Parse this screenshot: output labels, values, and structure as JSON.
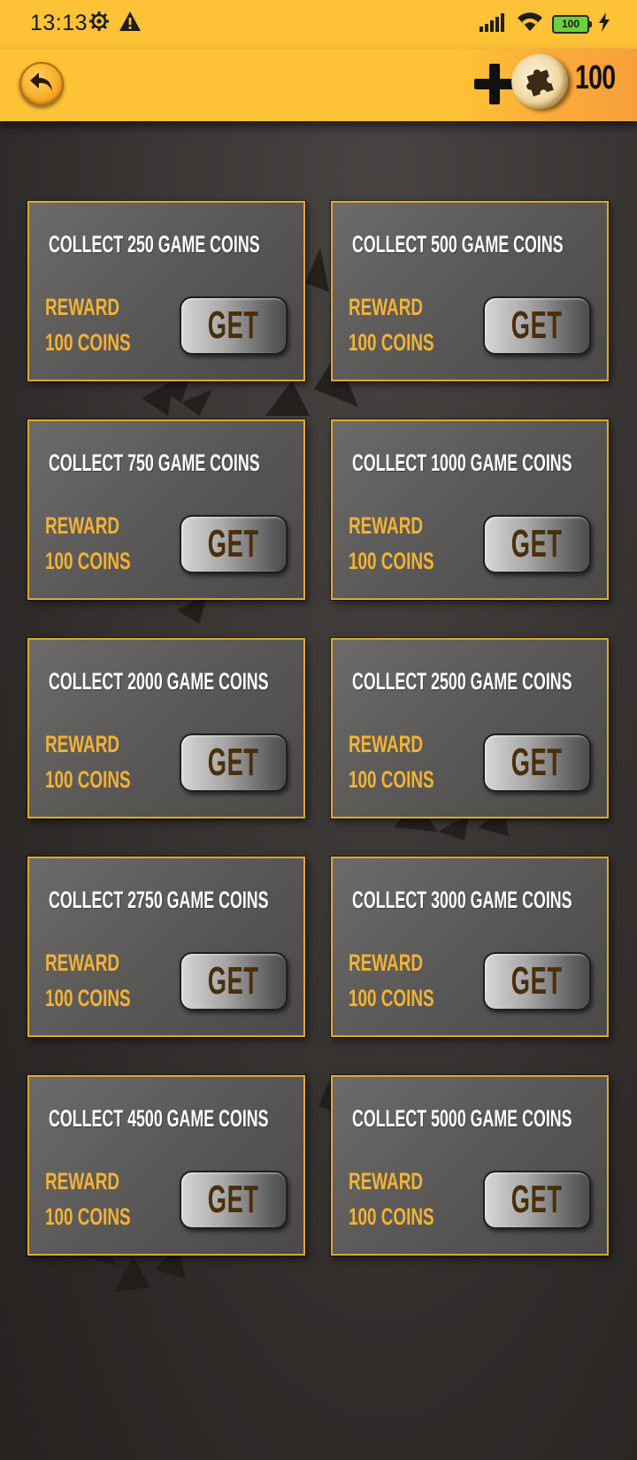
{
  "status_bar": {
    "time": "13:13",
    "battery": "100",
    "icons": [
      "gear-icon",
      "warning-icon",
      "signal-icon",
      "wifi-icon",
      "battery-icon",
      "charging-icon"
    ]
  },
  "header": {
    "coin_balance": "100",
    "icons": [
      "back-arrow-icon",
      "plus-icon",
      "puzzle-coin-icon"
    ],
    "colors": {
      "bar": "#fdc236",
      "accent": "#f7a03a"
    }
  },
  "cards": [
    {
      "title": "COLLECT 250 GAME COINS",
      "reward_line1": "REWARD",
      "reward_line2": "100 COINS",
      "button": "GET"
    },
    {
      "title": "COLLECT 500 GAME COINS",
      "reward_line1": "REWARD",
      "reward_line2": "100 COINS",
      "button": "GET"
    },
    {
      "title": "COLLECT 750 GAME COINS",
      "reward_line1": "REWARD",
      "reward_line2": "100 COINS",
      "button": "GET"
    },
    {
      "title": "COLLECT 1000 GAME COINS",
      "reward_line1": "REWARD",
      "reward_line2": "100 COINS",
      "button": "GET"
    },
    {
      "title": "COLLECT 2000 GAME COINS",
      "reward_line1": "REWARD",
      "reward_line2": "100 COINS",
      "button": "GET"
    },
    {
      "title": "COLLECT 2500 GAME COINS",
      "reward_line1": "REWARD",
      "reward_line2": "100 COINS",
      "button": "GET"
    },
    {
      "title": "COLLECT 2750 GAME COINS",
      "reward_line1": "REWARD",
      "reward_line2": "100 COINS",
      "button": "GET"
    },
    {
      "title": "COLLECT 3000 GAME COINS",
      "reward_line1": "REWARD",
      "reward_line2": "100 COINS",
      "button": "GET"
    },
    {
      "title": "COLLECT 4500 GAME COINS",
      "reward_line1": "REWARD",
      "reward_line2": "100 COINS",
      "button": "GET"
    },
    {
      "title": "COLLECT 5000 GAME COINS",
      "reward_line1": "REWARD",
      "reward_line2": "100 COINS",
      "button": "GET"
    }
  ],
  "colors": {
    "card_border": "#e0a830",
    "reward_text": "#f3b234",
    "button_text": "#4a2f0b",
    "background": "#2c2927"
  }
}
